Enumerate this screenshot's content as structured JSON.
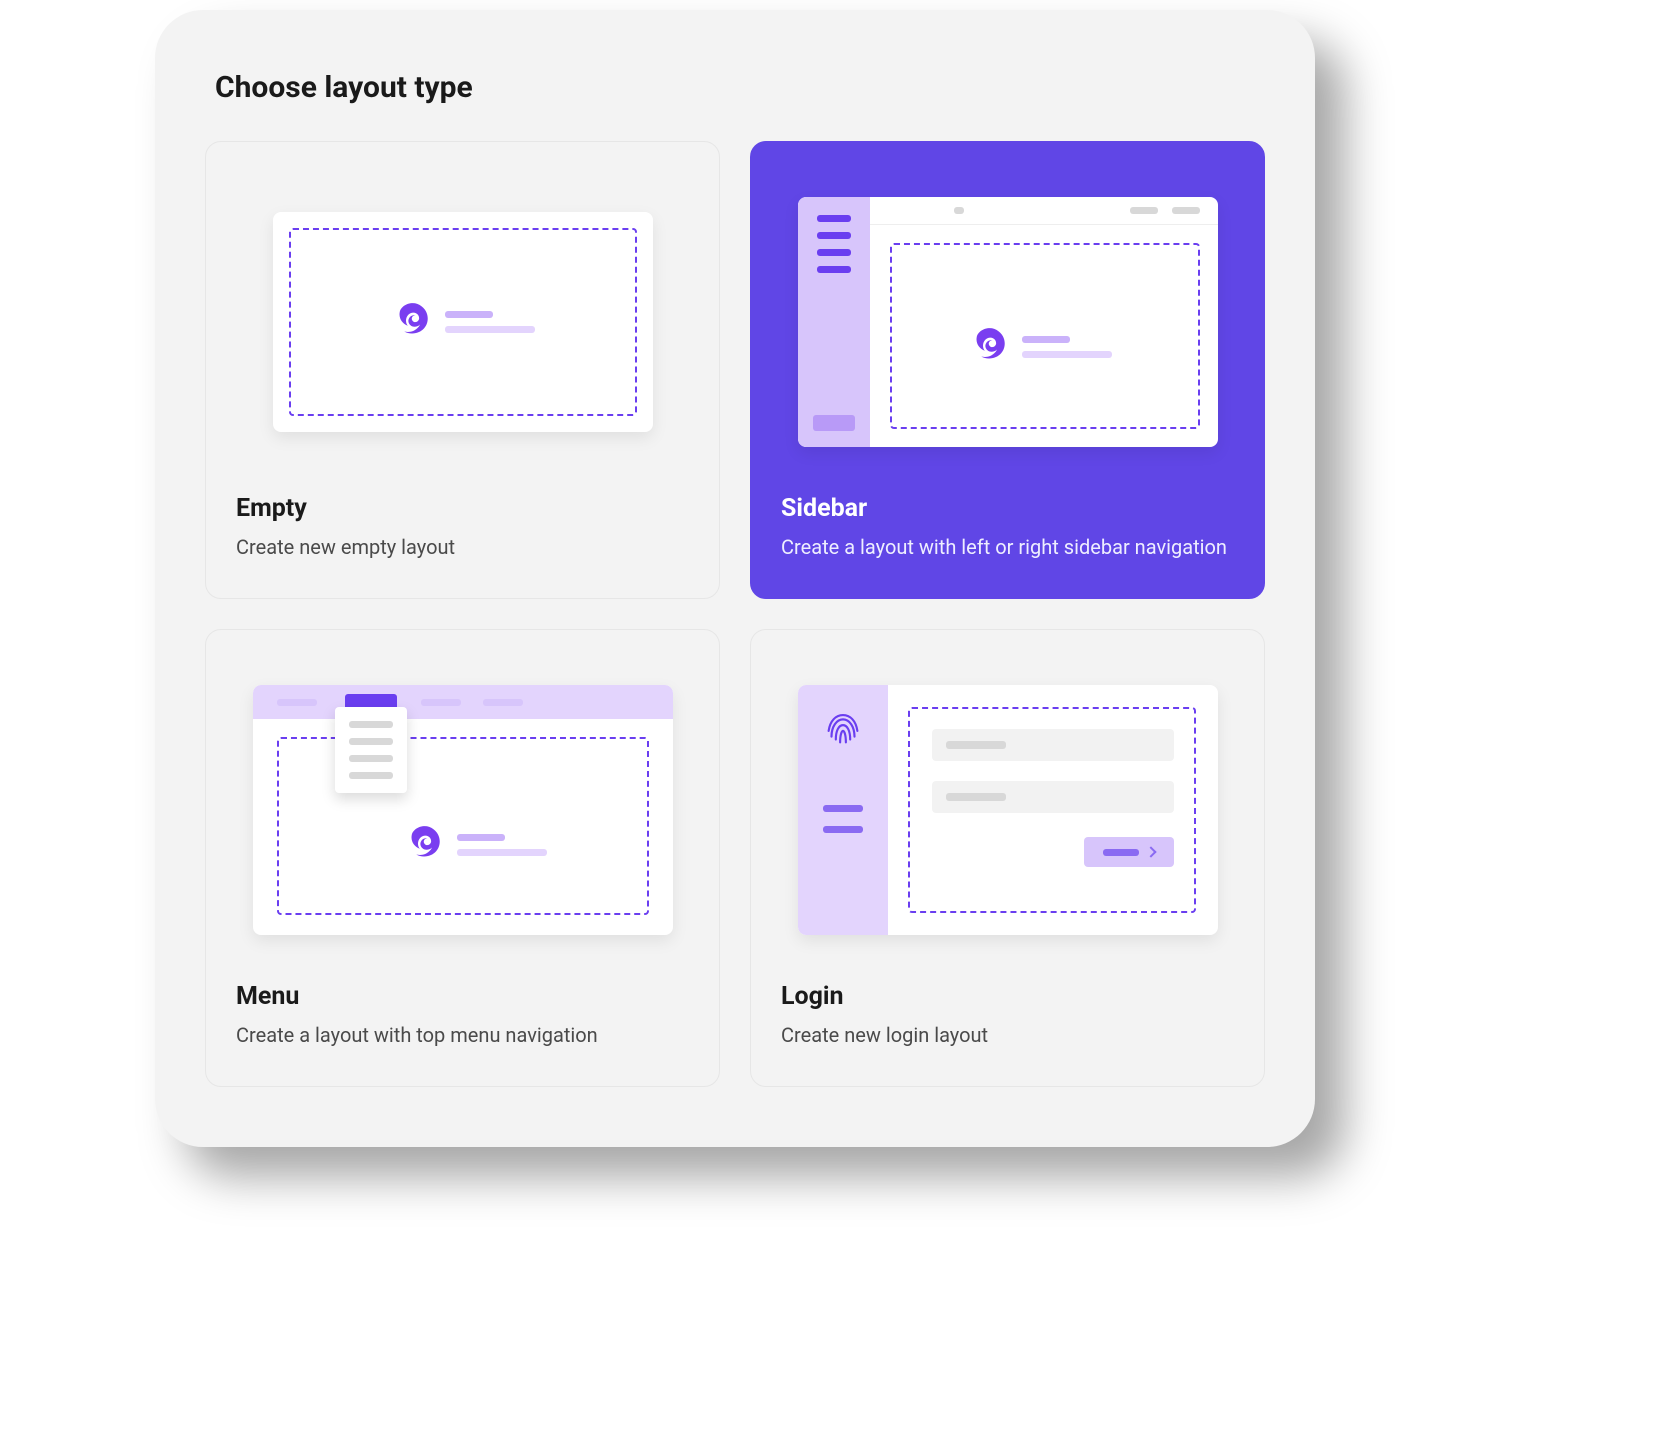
{
  "title": "Choose layout type",
  "accent": "#6046e6",
  "options": [
    {
      "id": "empty",
      "title": "Empty",
      "desc": "Create new empty layout",
      "selected": false
    },
    {
      "id": "sidebar",
      "title": "Sidebar",
      "desc": "Create a layout with left or right sidebar navigation",
      "selected": true
    },
    {
      "id": "menu",
      "title": "Menu",
      "desc": "Create a layout with top menu navigation",
      "selected": false
    },
    {
      "id": "login",
      "title": "Login",
      "desc": "Create new login layout",
      "selected": false
    }
  ]
}
